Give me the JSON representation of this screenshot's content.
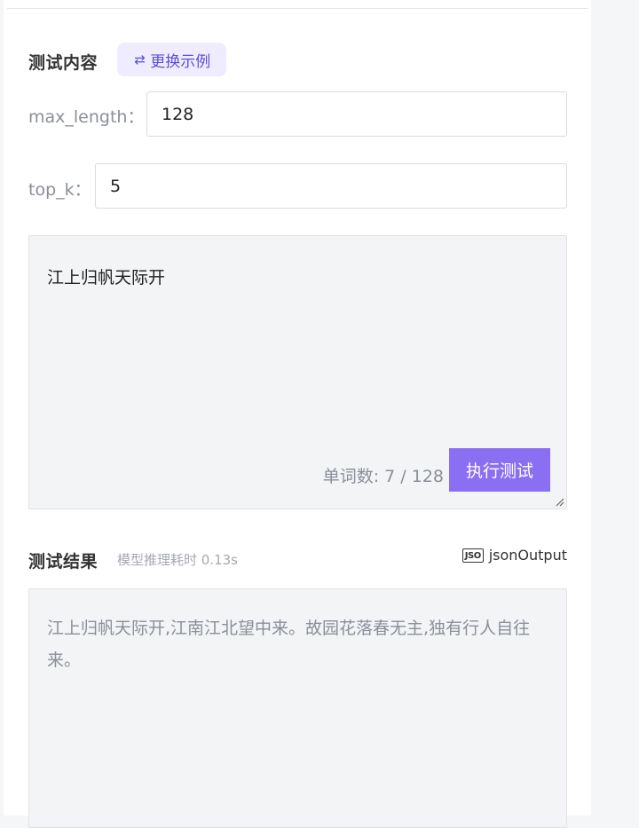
{
  "test_content": {
    "title": "测试内容",
    "swap_button_label": "更换示例",
    "swap_icon": "swap-icon"
  },
  "params": {
    "max_length": {
      "label": "max_length：",
      "value": "128"
    },
    "top_k": {
      "label": "top_k：",
      "value": "5"
    }
  },
  "input": {
    "text": "江上归帆天际开",
    "word_count": "单词数: 7 / 128",
    "run_button_label": "执行测试"
  },
  "result": {
    "title": "测试结果",
    "meta": "模型推理耗时 0.13s",
    "json_icon_text": "JSO",
    "json_output_label": "jsonOutput",
    "output_text": "江上归帆天际开,江南江北望中来。故园花落春无主,独有行人自往来。"
  }
}
